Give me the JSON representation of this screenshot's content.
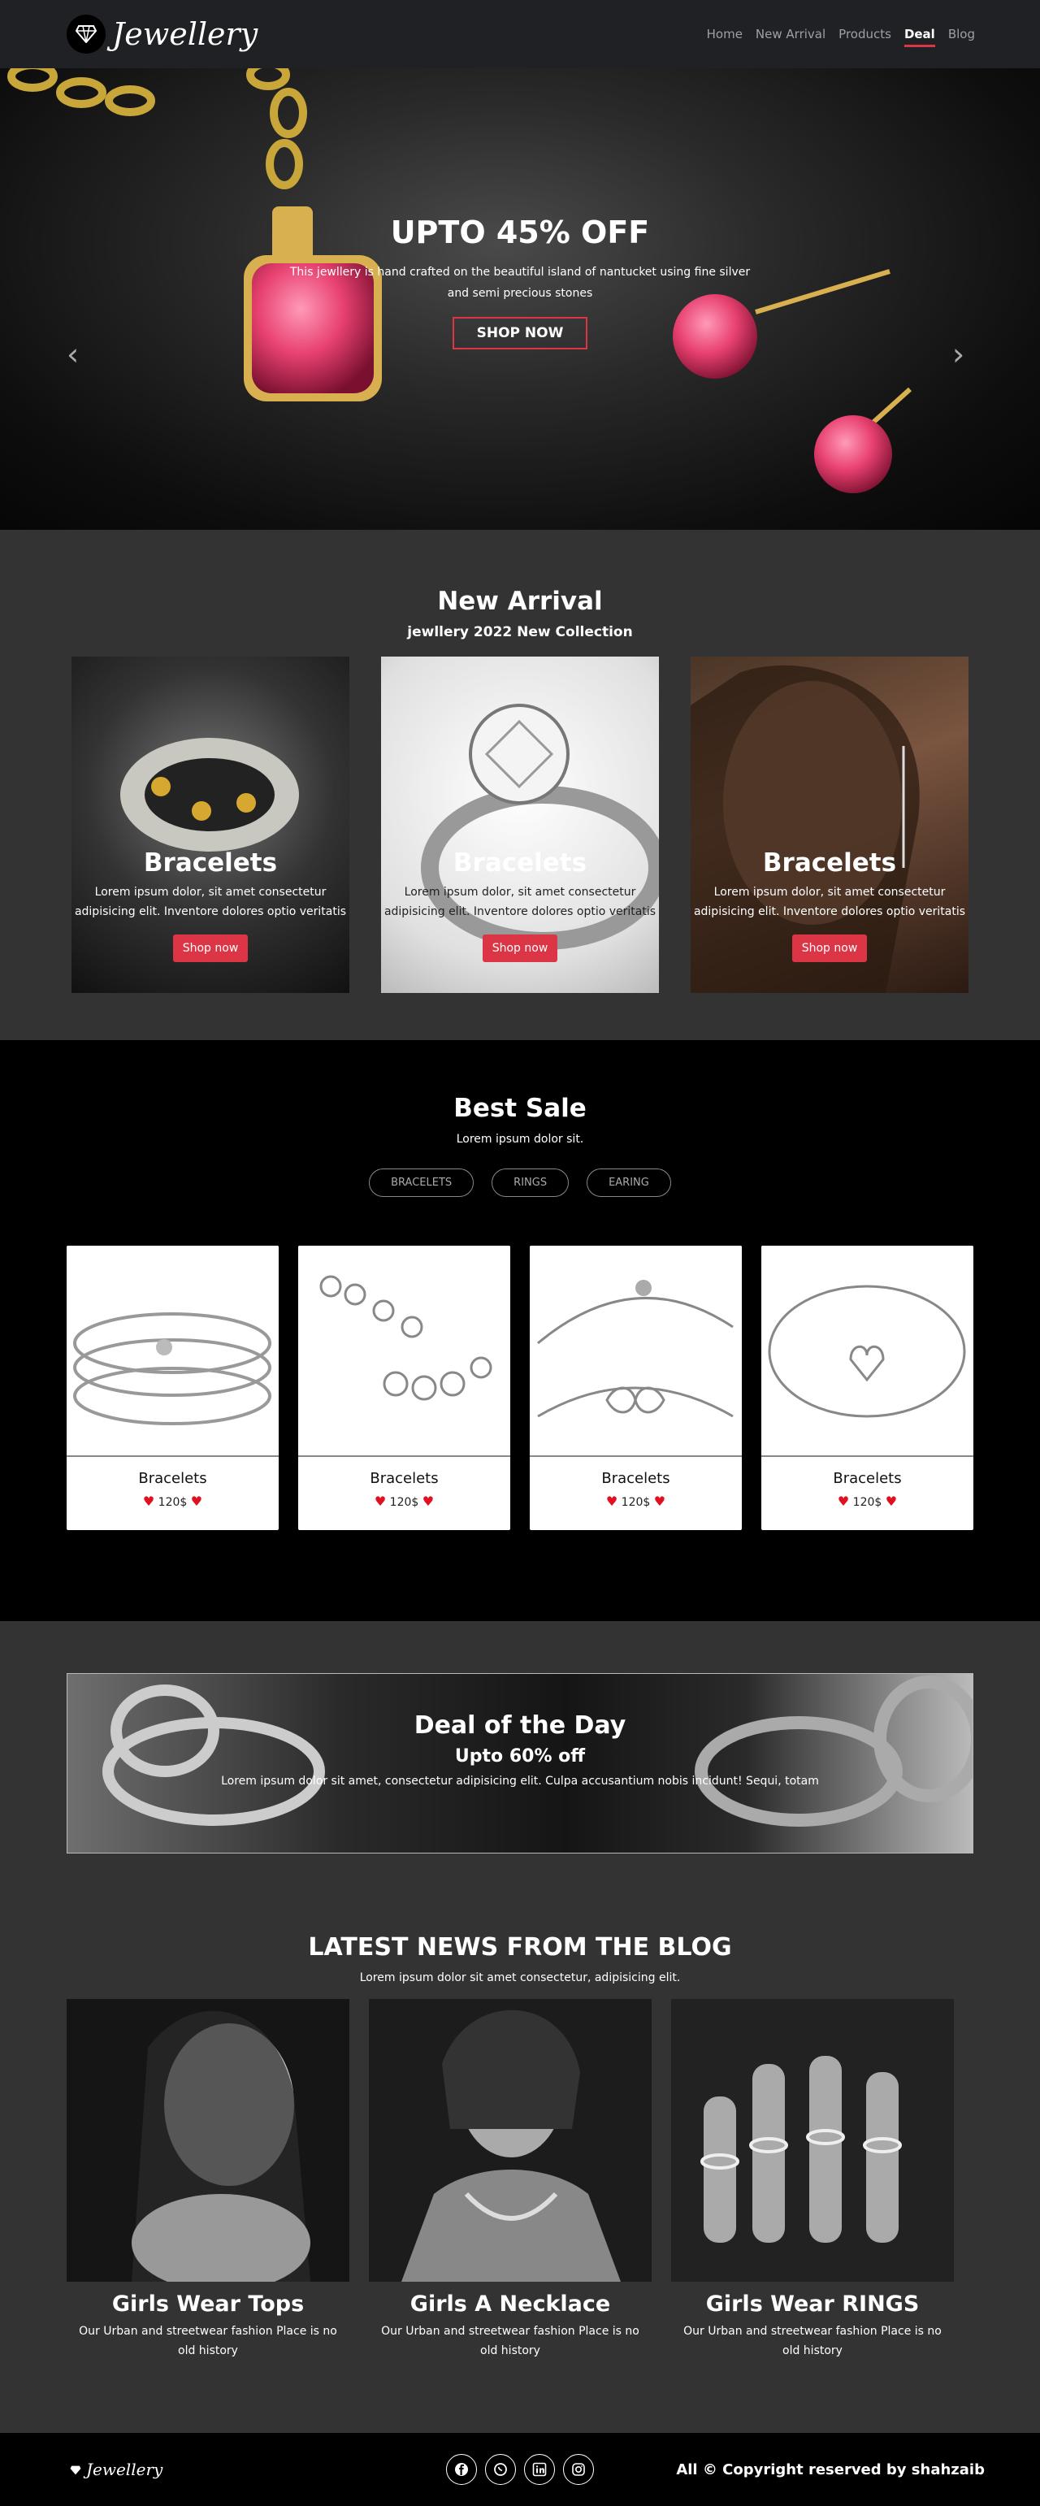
{
  "nav": {
    "brand": "Jewellery",
    "links": [
      {
        "label": "Home"
      },
      {
        "label": "New Arrival"
      },
      {
        "label": "Products"
      },
      {
        "label": "Deal"
      },
      {
        "label": "Blog"
      }
    ],
    "active": "Deal",
    "icon": "diamond-icon"
  },
  "hero": {
    "title": "UPTO 45% OFF",
    "text": "This jewllery is hand crafted on the beautiful island of nantucket using fine silver and semi precious stones",
    "button": "SHOP NOW",
    "prev_icon": "chevron-left-icon",
    "next_icon": "chevron-right-icon"
  },
  "arrival": {
    "title": "New Arrival",
    "subtitle": "jewllery 2022 New Collection",
    "cards": [
      {
        "title": "Bracelets",
        "text": "Lorem ipsum dolor, sit amet consectetur adipisicing elit. Inventore dolores optio veritatis",
        "button": "Shop now"
      },
      {
        "title": "Bracelets",
        "text": "Lorem ipsum dolor, sit amet consectetur adipisicing elit. Inventore dolores optio veritatis",
        "button": "Shop now"
      },
      {
        "title": "Bracelets",
        "text": "Lorem ipsum dolor, sit amet consectetur adipisicing elit. Inventore dolores optio veritatis",
        "button": "Shop now"
      }
    ]
  },
  "best": {
    "title": "Best Sale",
    "subtitle": "Lorem ipsum dolor sit.",
    "filters": [
      "BRACELETS",
      "RINGS",
      "EARING"
    ],
    "products": [
      {
        "name": "Bracelets",
        "price": "120$"
      },
      {
        "name": "Bracelets",
        "price": "120$"
      },
      {
        "name": "Bracelets",
        "price": "120$"
      },
      {
        "name": "Bracelets",
        "price": "120$"
      }
    ],
    "heart_icon": "heart-icon"
  },
  "deal": {
    "title": "Deal of the Day",
    "subtitle": "Upto 60% off",
    "text": "Lorem ipsum dolor sit amet, consectetur adipisicing elit. Culpa accusantium nobis incidunt! Sequi, totam"
  },
  "blog": {
    "title": "LATEST NEWS FROM THE BLOG",
    "subtitle": "Lorem ipsum dolor sit amet consectetur, adipisicing elit.",
    "posts": [
      {
        "title": "Girls Wear Tops",
        "text": "Our Urban and streetwear fashion Place is no old history"
      },
      {
        "title": "Girls A Necklace",
        "text": "Our Urban and streetwear fashion Place is no old history"
      },
      {
        "title": "Girls Wear RINGS",
        "text": "Our Urban and streetwear fashion Place is no old history"
      }
    ]
  },
  "footer": {
    "brand": "Jewellery",
    "socials": [
      "facebook-icon",
      "whatsapp-icon",
      "linkedin-icon",
      "instagram-icon"
    ],
    "copyright": "All © Copyright reserved by shahzaib"
  },
  "colors": {
    "accent": "#dc3545",
    "nav_bg": "#1f2124",
    "section_bg": "#333333",
    "best_bg": "#000000"
  }
}
